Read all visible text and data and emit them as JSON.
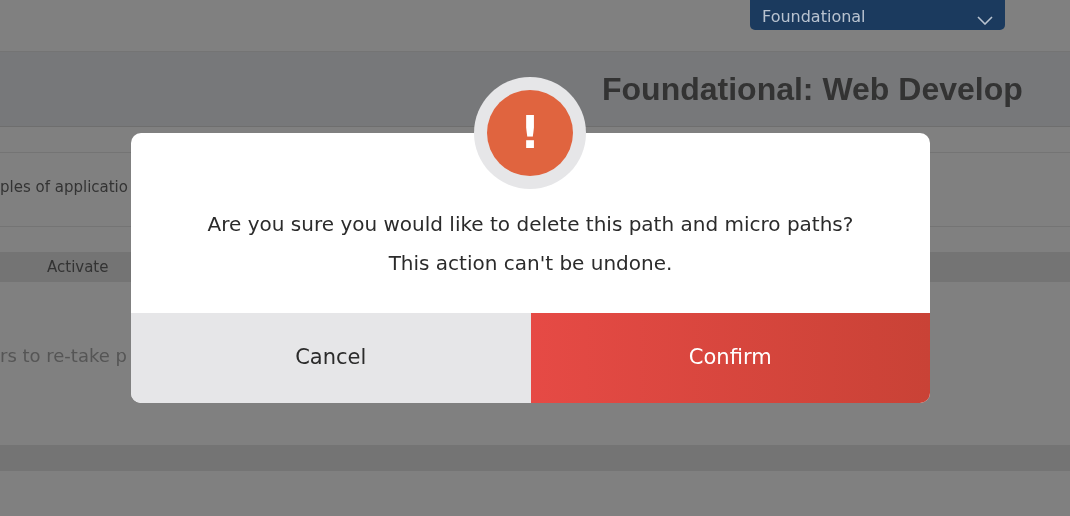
{
  "header": {
    "level_select": {
      "value": "Foundational"
    }
  },
  "path_title": "Foundational: Web Develop",
  "description": "ples of applicatio",
  "table": {
    "columns": [
      "Activate"
    ]
  },
  "note": "rs to re-take p",
  "dialog": {
    "icon": "!",
    "message": [
      "Are you sure you would like to delete this path and micro paths?",
      "This action can't be undone."
    ],
    "buttons": [
      {
        "kind": "cancel",
        "label": "Cancel"
      },
      {
        "kind": "confirm",
        "label": "Confirm"
      }
    ]
  }
}
